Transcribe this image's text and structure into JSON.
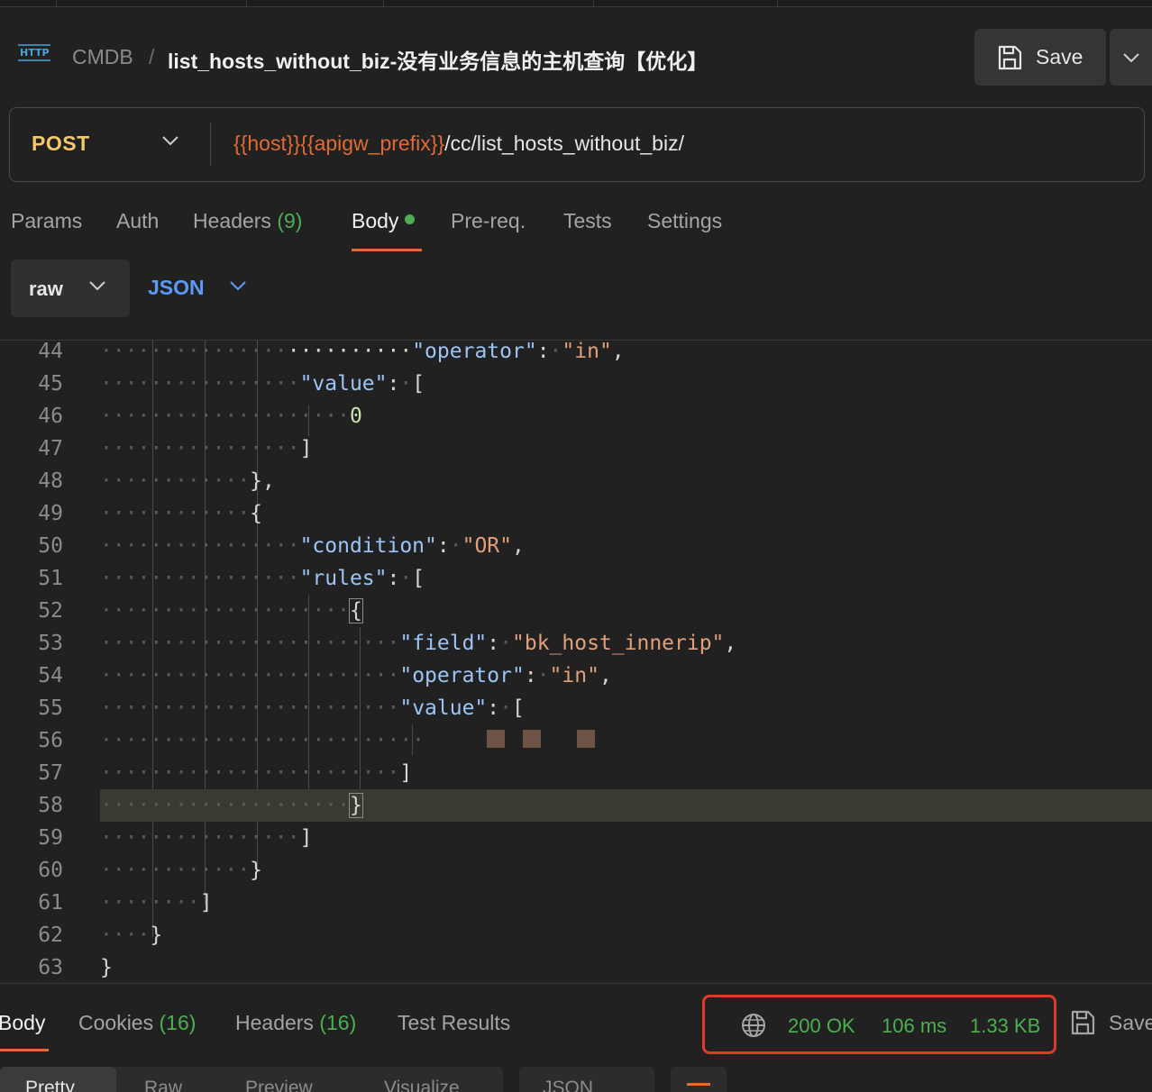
{
  "header": {
    "breadcrumb_parent": "CMDB",
    "breadcrumb_sep": "/",
    "title": "list_hosts_without_biz-没有业务信息的主机查询【优化】",
    "save_label": "Save",
    "icons": {
      "request_type": "http-icon",
      "save": "save-icon",
      "more": "chevron-down-icon"
    }
  },
  "request": {
    "method": "POST",
    "url_var1": "{{host}}",
    "url_var2": "{{apigw_prefix}}",
    "url_path": "/cc/list_hosts_without_biz/"
  },
  "tabs": {
    "params": "Params",
    "auth": "Auth",
    "headers": "Headers",
    "headers_count": "(9)",
    "body": "Body",
    "prereq": "Pre-req.",
    "tests": "Tests",
    "settings": "Settings",
    "active": "Body"
  },
  "body_options": {
    "mode": "raw",
    "language": "JSON"
  },
  "editor": {
    "line_numbers": [
      "44",
      "45",
      "46",
      "47",
      "48",
      "49",
      "50",
      "51",
      "52",
      "53",
      "54",
      "55",
      "56",
      "57",
      "58",
      "59",
      "60",
      "61",
      "62",
      "63"
    ],
    "highlighted_line": "58",
    "tokens": {
      "operator_key": "\"operator\"",
      "in_val": "\"in\"",
      "value_key": "\"value\"",
      "zero": "0",
      "condition_key": "\"condition\"",
      "or_val": "\"OR\"",
      "rules_key": "\"rules\"",
      "field_key": "\"field\"",
      "field_val": "\"bk_host_innerip\""
    }
  },
  "response": {
    "tabs": {
      "body": "Body",
      "cookies": "Cookies",
      "cookies_count": "(16)",
      "headers": "Headers",
      "headers_count": "(16)",
      "test_results": "Test Results"
    },
    "status": "200 OK",
    "time": "106 ms",
    "size": "1.33 KB",
    "save_label": "Save",
    "view_tabs": [
      "Pretty",
      "Raw",
      "Preview",
      "Visualize"
    ],
    "format": "JSON"
  },
  "colors": {
    "accent": "#e06b35",
    "method": "#f5c86a",
    "success": "#4caf50",
    "link": "#5b9bf7",
    "highlight_box": "#e0392b"
  }
}
